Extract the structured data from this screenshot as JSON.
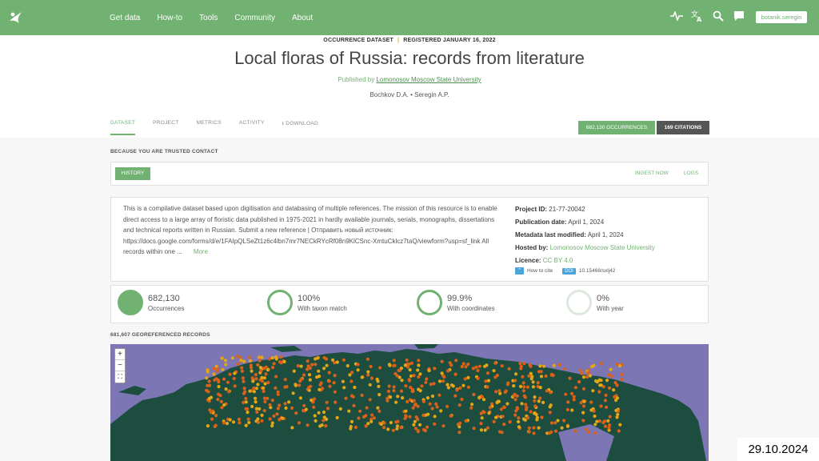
{
  "nav": {
    "items": [
      "Get data",
      "How-to",
      "Tools",
      "Community",
      "About"
    ],
    "user_label": "botanik.seregin"
  },
  "header": {
    "type_label": "OCCURRENCE DATASET",
    "registered": "REGISTERED JANUARY 16, 2022",
    "title": "Local floras of Russia: records from literature",
    "published_prefix": "Published by",
    "publisher": "Lomonosov Moscow State University",
    "authors": "Bochkov D.A. • Seregin A.P."
  },
  "tabs": [
    "DATASET",
    "PROJECT",
    "METRICS",
    "ACTIVITY",
    "DOWNLOAD"
  ],
  "buttons": {
    "occurrences": "682,130 OCCURRENCES",
    "citations": "169 CITATIONS"
  },
  "trusted_label": "BECAUSE YOU ARE TRUSTED CONTACT",
  "history": {
    "history": "HISTORY",
    "ingest": "INGEST NOW",
    "logs": "LOGS"
  },
  "description": {
    "text": "This is a compilative dataset based upon digitisation and databasing of multiple references. The mission of this resource is to enable direct access to a large array of floristic data published in 1975-2021 in hardly available journals, serials, monographs, dissertations and technical reports written in Russian. Submit a new reference | Отправить новый источник: https://docs.google.com/forms/d/e/1FAIpQLSeZt1z6c4lbn7mr7NECkRYcRf08n9KlCSnc-XmtuCklcz7taQ/viewform?usp=sf_link All records within one ...",
    "more": "More"
  },
  "facts": {
    "project_label": "Project ID:",
    "project_value": "21-77-20042",
    "pubdate_label": "Publication date:",
    "pubdate_value": "April 1, 2024",
    "modified_label": "Metadata last modified:",
    "modified_value": "April 1, 2024",
    "hosted_label": "Hosted by:",
    "hosted_value": "Lomonosov Moscow State University",
    "licence_label": "Licence:",
    "licence_value": "CC BY 4.0",
    "how_to_cite": "How to cite",
    "doi_label": "DOI",
    "doi_value": "10.15468/sxlj42"
  },
  "stats": [
    {
      "value": "682,130",
      "label": "Occurrences"
    },
    {
      "value": "100%",
      "label": "With taxon match"
    },
    {
      "value": "99.9%",
      "label": "With coordinates"
    },
    {
      "value": "0%",
      "label": "With year"
    }
  ],
  "geo_label": "681,607 GEOREFERENCED RECORDS",
  "date_stamp": "29.10.2024",
  "colors": {
    "brand": "#71b171",
    "map_water": "#7d76b4",
    "map_land": "#1d4d3f",
    "dot_hi": "#e4a615",
    "dot_lo": "#d9611a"
  }
}
